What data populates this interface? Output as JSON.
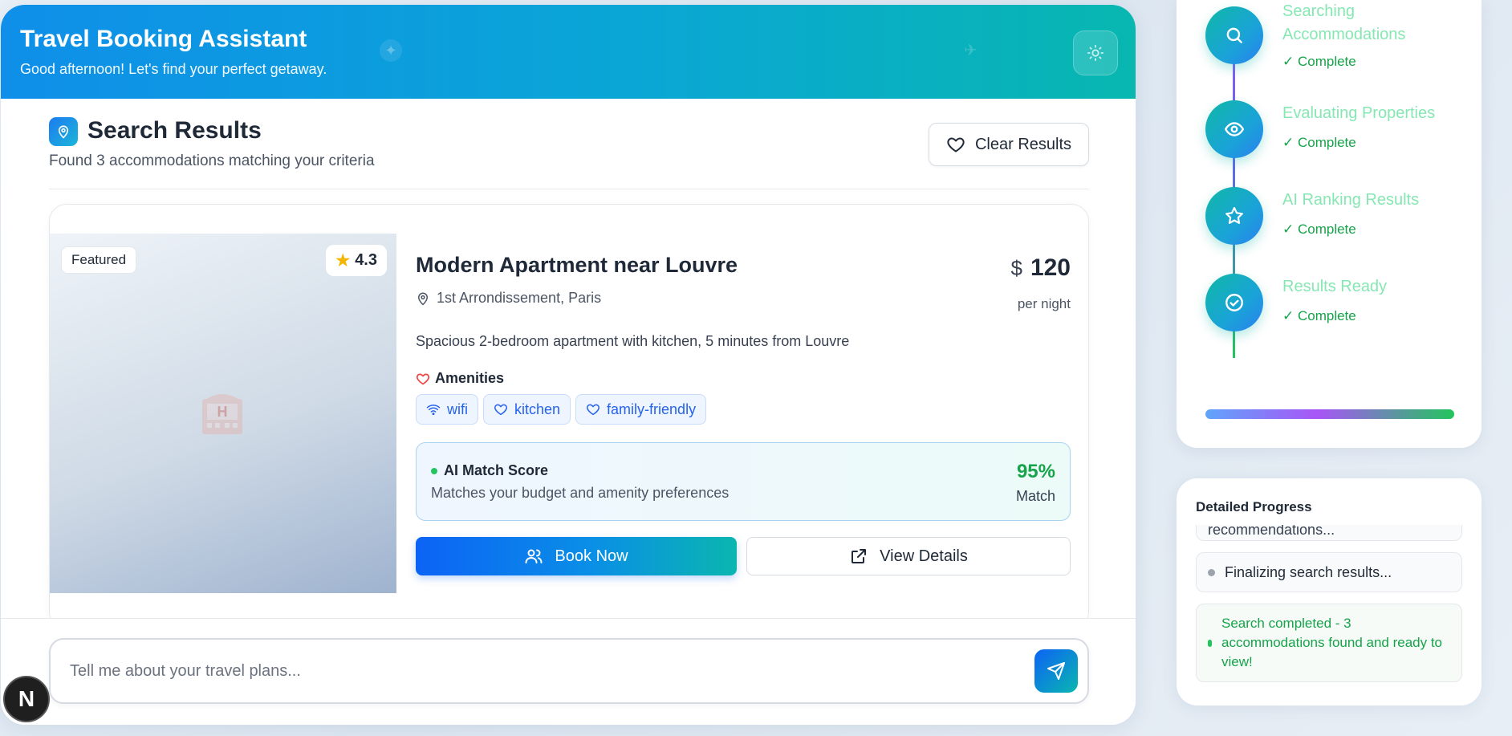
{
  "header": {
    "title": "Travel Booking Assistant",
    "subtitle": "Good afternoon! Let's find your perfect getaway."
  },
  "results": {
    "title": "Search Results",
    "count_text": "Found 3 accommodations matching your criteria",
    "clear_label": "Clear Results"
  },
  "property": {
    "featured_label": "Featured",
    "rating": "4.3",
    "name": "Modern Apartment near Louvre",
    "location": "1st Arrondissement, Paris",
    "price_currency": "$",
    "price": "120",
    "price_unit": "per night",
    "description": "Spacious 2-bedroom apartment with kitchen, 5 minutes from Louvre",
    "amenities_title": "Amenities",
    "amenities": [
      "wifi",
      "kitchen",
      "family-friendly"
    ],
    "match": {
      "title": "AI Match Score",
      "subtitle": "Matches your budget and amenity preferences",
      "value": "95%",
      "label": "Match"
    },
    "book_label": "Book Now",
    "details_label": "View Details"
  },
  "chat": {
    "placeholder": "Tell me about your travel plans..."
  },
  "progress": {
    "steps": [
      {
        "label": "Searching Accommodations",
        "status": "✓ Complete",
        "icon": "search-icon"
      },
      {
        "label": "Evaluating Properties",
        "status": "✓ Complete",
        "icon": "eye-icon"
      },
      {
        "label": "AI Ranking Results",
        "status": "✓ Complete",
        "icon": "star-icon"
      },
      {
        "label": "Results Ready",
        "status": "✓ Complete",
        "icon": "check-circle-icon"
      }
    ],
    "overall_progress": 1.0
  },
  "detailed": {
    "title": "Detailed Progress",
    "logs": [
      {
        "text": "recommendations...",
        "type": "pending"
      },
      {
        "text": "Finalizing search results...",
        "type": "pending"
      },
      {
        "text": "Search completed - 3 accommodations found and ready to view!",
        "type": "success"
      }
    ]
  },
  "colors": {
    "accent_blue": "#0c63f5",
    "accent_teal": "#0ab6b0",
    "success_green": "#16a34a",
    "step_label_green": "#86e7b3"
  }
}
